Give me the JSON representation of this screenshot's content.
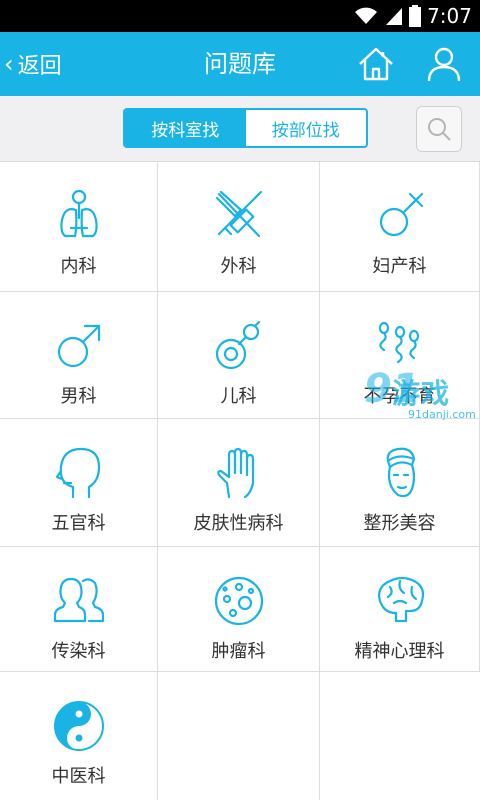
{
  "status_bar": {
    "time": "7:07"
  },
  "header": {
    "back_label": "返回",
    "title": "问题库",
    "accent_color": "#1ab3e6"
  },
  "toolbar": {
    "segments": [
      {
        "label": "按科室找",
        "active": true
      },
      {
        "label": "按部位找",
        "active": false
      }
    ]
  },
  "departments": [
    {
      "label": "内科",
      "icon": "lungs-icon"
    },
    {
      "label": "外科",
      "icon": "scalpel-syringe-icon"
    },
    {
      "label": "妇产科",
      "icon": "female-symbol-icon"
    },
    {
      "label": "男科",
      "icon": "male-symbol-icon"
    },
    {
      "label": "儿科",
      "icon": "pacifier-icon"
    },
    {
      "label": "不孕不育",
      "icon": "sperm-icon"
    },
    {
      "label": "五官科",
      "icon": "head-profile-icon"
    },
    {
      "label": "皮肤性病科",
      "icon": "hand-icon"
    },
    {
      "label": "整形美容",
      "icon": "face-towel-icon"
    },
    {
      "label": "传染科",
      "icon": "two-people-icon"
    },
    {
      "label": "肿瘤科",
      "icon": "cell-icon"
    },
    {
      "label": "精神心理科",
      "icon": "brain-icon"
    },
    {
      "label": "中医科",
      "icon": "yin-yang-icon"
    }
  ],
  "watermark": {
    "brand": "游戏",
    "number": "91",
    "url": "91danji.com"
  }
}
